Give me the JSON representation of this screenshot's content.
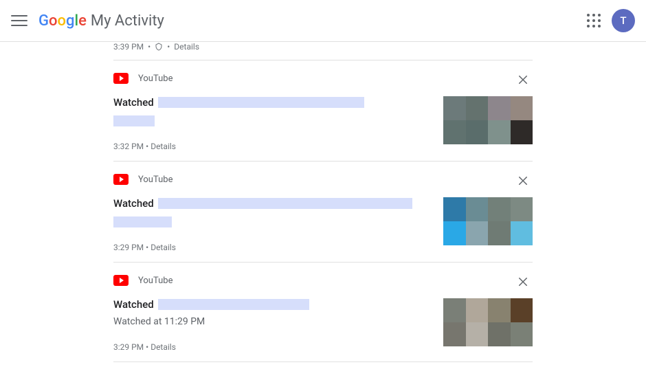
{
  "header": {
    "app_title_suffix": "My Activity",
    "avatar_initial": "T"
  },
  "partial": {
    "time": "3:39 PM",
    "details_label": "Details"
  },
  "items": [
    {
      "service": "YouTube",
      "watched_label": "Watched",
      "time": "3:32 PM",
      "details_label": "Details",
      "thumb_colors": [
        "#6c7a7a",
        "#64726e",
        "#8d868c",
        "#958880",
        "#60726f",
        "#5a6d6b",
        "#7f918c",
        "#2e2a28"
      ]
    },
    {
      "service": "YouTube",
      "watched_label": "Watched",
      "time": "3:29 PM",
      "details_label": "Details",
      "thumb_colors": [
        "#2e7aa8",
        "#6a8c94",
        "#728079",
        "#7d8a83",
        "#2aa8e6",
        "#8aa5ae",
        "#6f7b74",
        "#60bde0"
      ]
    },
    {
      "service": "YouTube",
      "watched_label": "Watched",
      "subtext": "Watched at 11:29 PM",
      "time": "3:29 PM",
      "details_label": "Details",
      "thumb_colors": [
        "#7a7f77",
        "#b0a79a",
        "#88826f",
        "#5a4028",
        "#77766e",
        "#b5b0a7",
        "#6f7168",
        "#7a8076"
      ]
    }
  ]
}
